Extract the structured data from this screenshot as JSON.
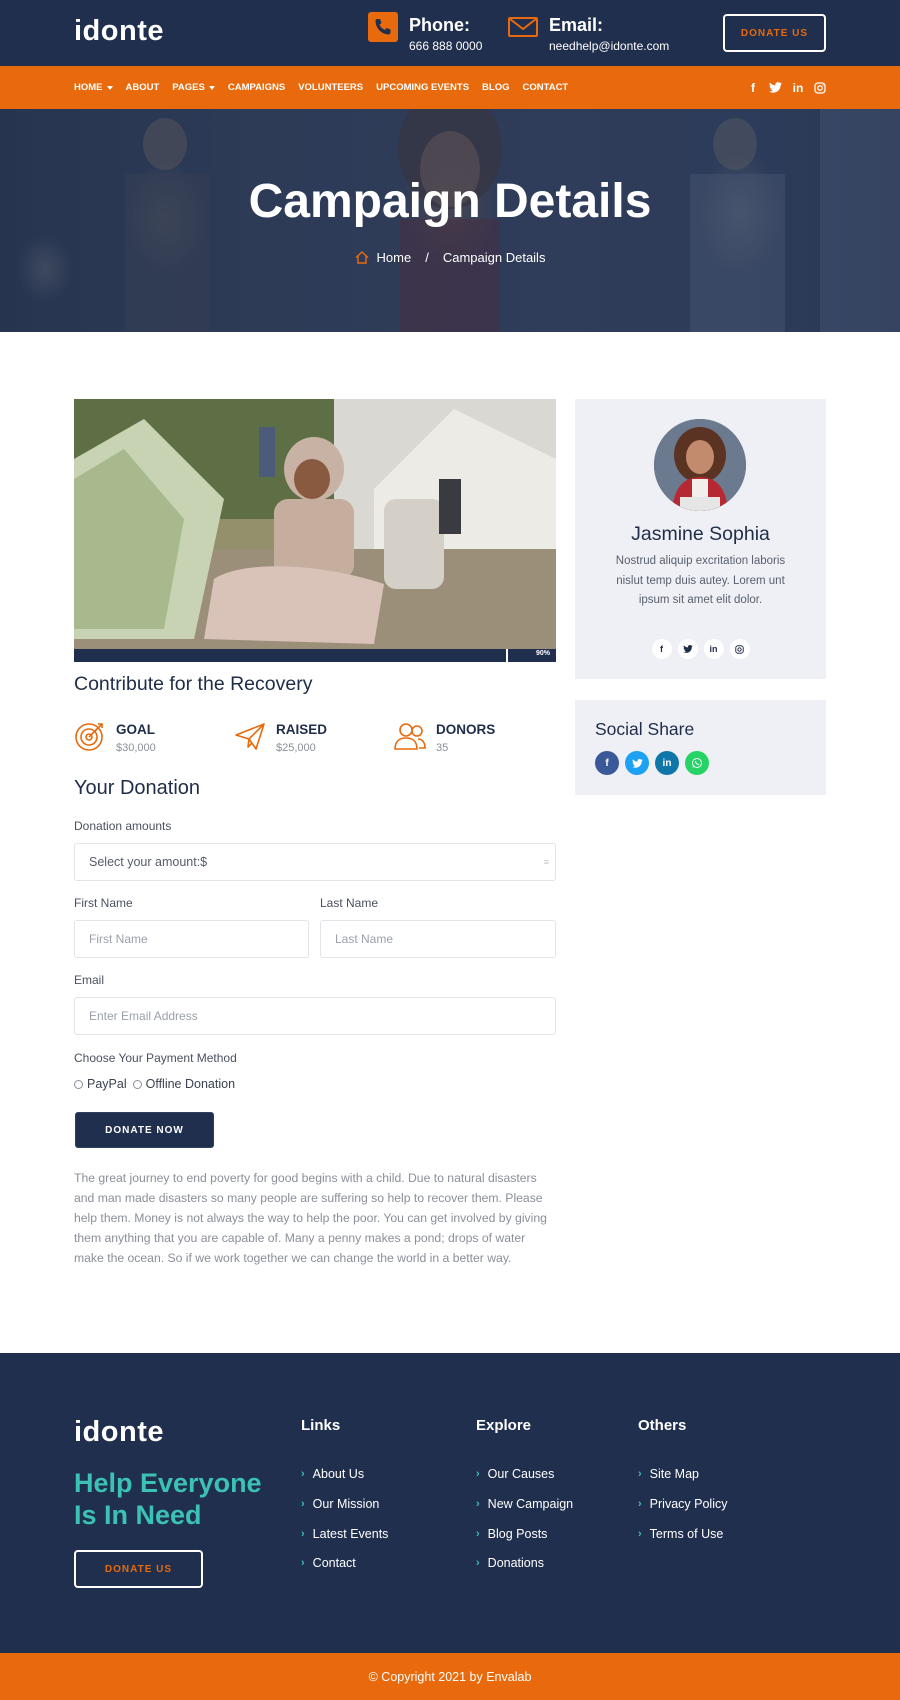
{
  "brand": {
    "logo": "idonte"
  },
  "header": {
    "phone_label": "Phone:",
    "phone_value": "666 888 0000",
    "email_label": "Email:",
    "email_value": "needhelp@idonte.com",
    "donate_button": "DONATE US"
  },
  "nav": {
    "items": [
      "HOME",
      "ABOUT",
      "PAGES",
      "CAMPAIGNS",
      "VOLUNTEERS",
      "UPCOMING EVENTS",
      "BLOG",
      "CONTACT"
    ],
    "social_icons": [
      "facebook-icon",
      "twitter-icon",
      "linkedin-icon",
      "instagram-icon"
    ]
  },
  "hero": {
    "title": "Campaign Details",
    "breadcrumb_home": "Home",
    "breadcrumb_separator": "/",
    "breadcrumb_current": "Campaign Details"
  },
  "campaign": {
    "progress_percent": 90,
    "progress_label": "90%",
    "title": "Contribute for the Recovery",
    "stats": {
      "goal_label": "GOAL",
      "goal_value": "$30,000",
      "raised_label": "RAISED",
      "raised_value": "$25,000",
      "donors_label": "DONORS",
      "donors_value": "35"
    }
  },
  "donation_form": {
    "heading": "Your Donation",
    "amount_label": "Donation amounts",
    "amount_select": "Select your amount:$",
    "first_name_label": "First Name",
    "first_name_placeholder": "First Name",
    "last_name_label": "Last Name",
    "last_name_placeholder": "Last Name",
    "email_label": "Email",
    "email_placeholder": "Enter Email Address",
    "payment_label": "Choose Your Payment Method",
    "payment_options": [
      "PayPal",
      "Offline Donation"
    ],
    "submit_label": "DONATE NOW"
  },
  "description": "The great journey to end poverty for good begins with a child. Due to natural disasters and man made disasters so many people are suffering so help to recover them. Please help them. Money is not always the way to help the poor. You can get involved by giving them anything that you are capable of. Many a penny makes a pond; drops of water make the ocean. So if we work together we can change the world in a better way.",
  "sidebar": {
    "author_name": "Jasmine Sophia",
    "author_bio": "Nostrud aliquip excritation laboris nislut temp duis autey. Lorem unt ipsum sit amet elit dolor.",
    "author_social_icons": [
      "facebook-icon",
      "twitter-icon",
      "linkedin-icon",
      "instagram-icon"
    ],
    "share_title": "Social Share",
    "share_icons": [
      "facebook-icon",
      "twitter-icon",
      "linkedin-icon",
      "whatsapp-icon"
    ]
  },
  "footer": {
    "logo": "idonte",
    "tagline": "Help Everyone Is In Need",
    "donate_button": "DONATE US",
    "links_title": "Links",
    "links": [
      "About Us",
      "Our Mission",
      "Latest Events",
      "Contact"
    ],
    "explore_title": "Explore",
    "explore": [
      "Our Causes",
      "New Campaign",
      "Blog Posts",
      "Donations"
    ],
    "others_title": "Others",
    "others": [
      "Site Map",
      "Privacy Policy",
      "Terms of Use"
    ],
    "copyright": "© Copyright 2021 by Envalab"
  },
  "colors": {
    "navy": "#1f2f4d",
    "orange": "#e86a0c",
    "teal": "#3bc2b4",
    "card_bg": "#eef0f6"
  }
}
